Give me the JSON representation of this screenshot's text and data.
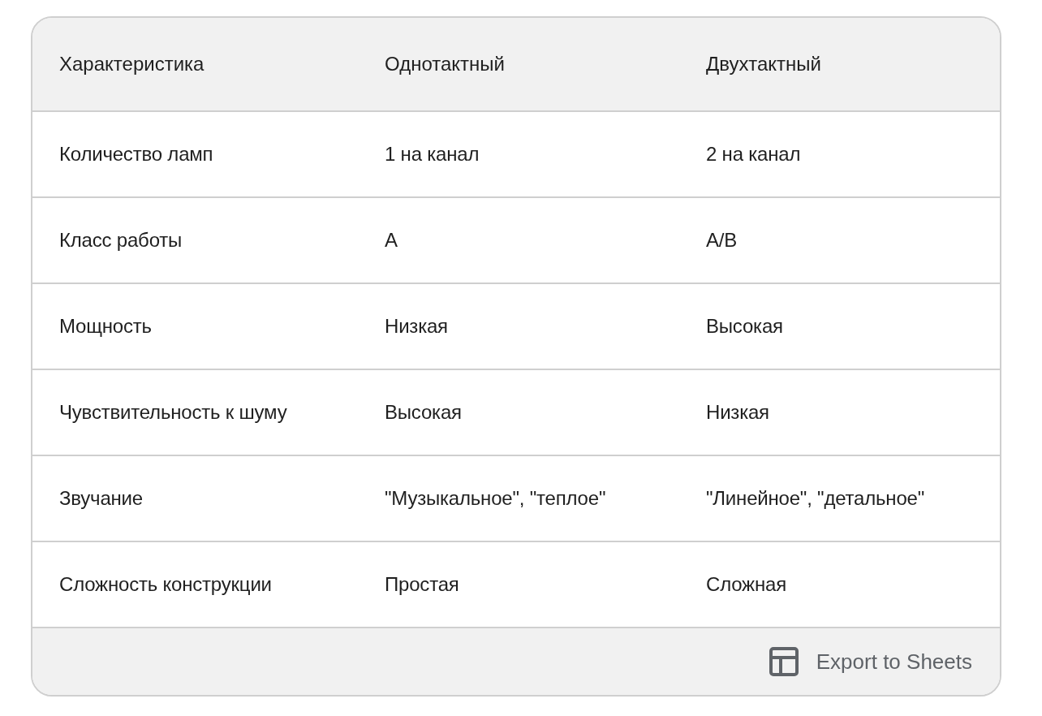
{
  "table": {
    "columns": [
      "Характеристика",
      "Однотактный",
      "Двухтактный"
    ],
    "rows": [
      [
        "Количество ламп",
        "1 на канал",
        "2 на канал"
      ],
      [
        "Класс работы",
        "A",
        "A/B"
      ],
      [
        "Мощность",
        "Низкая",
        "Высокая"
      ],
      [
        "Чувствительность к шуму",
        "Высокая",
        "Низкая"
      ],
      [
        "Звучание",
        "\"Музыкальное\", \"теплое\"",
        "\"Линейное\", \"детальное\""
      ],
      [
        "Сложность конструкции",
        "Простая",
        "Сложная"
      ]
    ]
  },
  "export_button": {
    "label": "Export to Sheets"
  }
}
